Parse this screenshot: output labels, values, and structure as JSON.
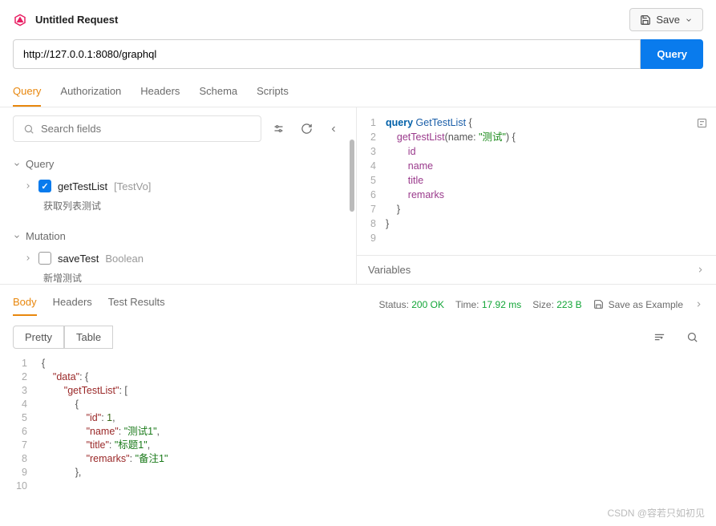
{
  "header": {
    "title": "Untitled Request",
    "save_label": "Save"
  },
  "url": {
    "value": "http://127.0.0.1:8080/graphql",
    "button_label": "Query"
  },
  "tabs": [
    "Query",
    "Authorization",
    "Headers",
    "Schema",
    "Scripts"
  ],
  "active_tab": 0,
  "search": {
    "placeholder": "Search fields"
  },
  "schema": {
    "query_section": "Query",
    "mutation_section": "Mutation",
    "query_items": [
      {
        "name": "getTestList",
        "type": "[TestVo]",
        "checked": true,
        "desc": "获取列表测试"
      }
    ],
    "mutation_items": [
      {
        "name": "saveTest",
        "type": "Boolean",
        "checked": false,
        "desc": "新增测试"
      }
    ]
  },
  "editor": {
    "lines": [
      {
        "n": 1,
        "segments": [
          [
            "kw",
            "query "
          ],
          [
            "fn",
            "GetTestList "
          ],
          [
            "brace",
            "{"
          ]
        ]
      },
      {
        "n": 2,
        "segments": [
          [
            "plain",
            "    "
          ],
          [
            "field",
            "getTestList"
          ],
          [
            "brace",
            "("
          ],
          [
            "arg",
            "name"
          ],
          [
            "brace",
            ": "
          ],
          [
            "str",
            "\"测试\""
          ],
          [
            "brace",
            ") {"
          ]
        ]
      },
      {
        "n": 3,
        "segments": [
          [
            "plain",
            "        "
          ],
          [
            "field",
            "id"
          ]
        ]
      },
      {
        "n": 4,
        "segments": [
          [
            "plain",
            "        "
          ],
          [
            "field",
            "name"
          ]
        ]
      },
      {
        "n": 5,
        "segments": [
          [
            "plain",
            "        "
          ],
          [
            "field",
            "title"
          ]
        ]
      },
      {
        "n": 6,
        "segments": [
          [
            "plain",
            "        "
          ],
          [
            "field",
            "remarks"
          ]
        ]
      },
      {
        "n": 7,
        "segments": [
          [
            "plain",
            "    "
          ],
          [
            "brace",
            "}"
          ]
        ]
      },
      {
        "n": 8,
        "segments": [
          [
            "brace",
            "}"
          ]
        ]
      },
      {
        "n": 9,
        "segments": [
          [
            "plain",
            ""
          ]
        ]
      }
    ]
  },
  "variables_label": "Variables",
  "response_tabs": [
    "Body",
    "Headers",
    "Test Results"
  ],
  "active_response_tab": 0,
  "status": {
    "status_label": "Status:",
    "status_value": "200 OK",
    "time_label": "Time:",
    "time_value": "17.92 ms",
    "size_label": "Size:",
    "size_value": "223 B",
    "save_example": "Save as Example"
  },
  "view_tabs": [
    "Pretty",
    "Table"
  ],
  "active_view_tab": 0,
  "response_body": {
    "lines": [
      {
        "n": 1,
        "segments": [
          [
            "json-brace",
            "{"
          ]
        ]
      },
      {
        "n": 2,
        "segments": [
          [
            "plain",
            "    "
          ],
          [
            "json-key",
            "\"data\""
          ],
          [
            "json-brace",
            ": {"
          ]
        ]
      },
      {
        "n": 3,
        "segments": [
          [
            "plain",
            "        "
          ],
          [
            "json-key",
            "\"getTestList\""
          ],
          [
            "json-brace",
            ": ["
          ]
        ]
      },
      {
        "n": 4,
        "segments": [
          [
            "plain",
            "            "
          ],
          [
            "json-brace",
            "{"
          ]
        ]
      },
      {
        "n": 5,
        "segments": [
          [
            "plain",
            "                "
          ],
          [
            "json-key",
            "\"id\""
          ],
          [
            "json-brace",
            ": "
          ],
          [
            "json-num",
            "1"
          ],
          [
            "json-brace",
            ","
          ]
        ]
      },
      {
        "n": 6,
        "segments": [
          [
            "plain",
            "                "
          ],
          [
            "json-key",
            "\"name\""
          ],
          [
            "json-brace",
            ": "
          ],
          [
            "json-str",
            "\"测试1\""
          ],
          [
            "json-brace",
            ","
          ]
        ]
      },
      {
        "n": 7,
        "segments": [
          [
            "plain",
            "                "
          ],
          [
            "json-key",
            "\"title\""
          ],
          [
            "json-brace",
            ": "
          ],
          [
            "json-str",
            "\"标题1\""
          ],
          [
            "json-brace",
            ","
          ]
        ]
      },
      {
        "n": 8,
        "segments": [
          [
            "plain",
            "                "
          ],
          [
            "json-key",
            "\"remarks\""
          ],
          [
            "json-brace",
            ": "
          ],
          [
            "json-str",
            "\"备注1\""
          ]
        ]
      },
      {
        "n": 9,
        "segments": [
          [
            "plain",
            "            "
          ],
          [
            "json-brace",
            "},"
          ]
        ]
      },
      {
        "n": 10,
        "segments": [
          [
            "plain",
            ""
          ]
        ]
      }
    ]
  },
  "watermark": "CSDN @容若只如初见"
}
